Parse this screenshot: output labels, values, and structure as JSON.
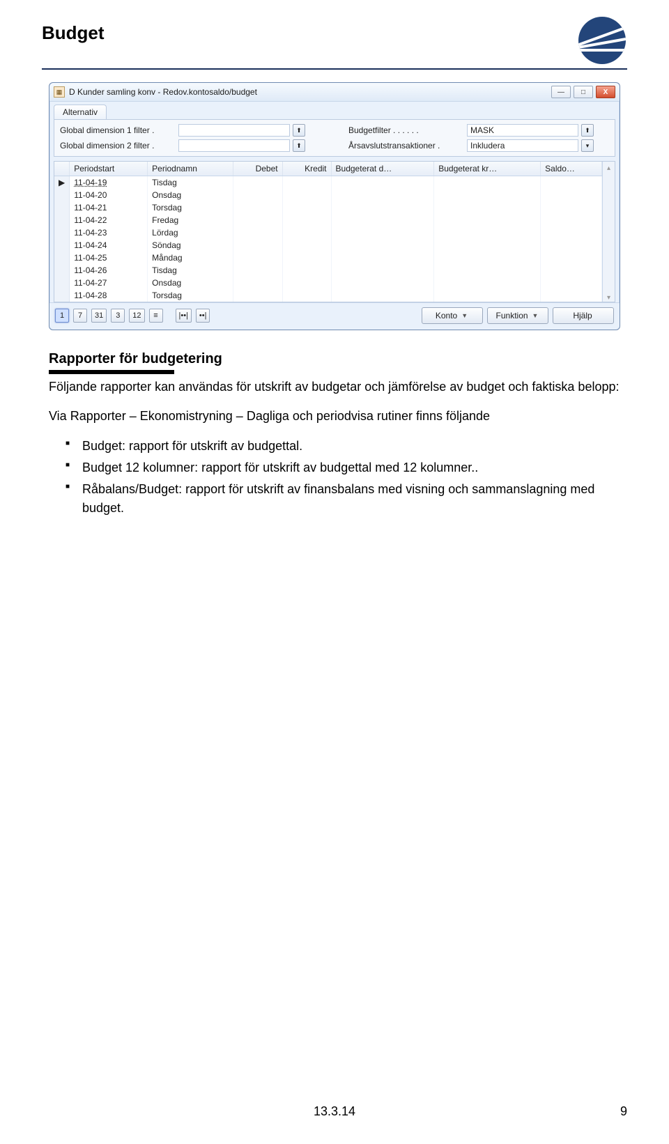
{
  "header": {
    "title": "Budget"
  },
  "window": {
    "icon_label": "📅",
    "title": "D Kunder samling konv - Redov.kontosaldo/budget",
    "buttons": {
      "min": "—",
      "max": "□",
      "close": "X"
    },
    "tab": "Alternativ",
    "filters": {
      "dim1_label": "Global dimension 1 filter .",
      "dim1_value": "",
      "dim2_label": "Global dimension 2 filter .",
      "dim2_value": "",
      "budget_label": "Budgetfilter . . . . . .",
      "budget_value": "MASK",
      "year_label": "Årsavslutstransaktioner .",
      "year_value": "Inkludera"
    },
    "columns": {
      "sel": "",
      "periodstart": "Periodstart",
      "periodnamn": "Periodnamn",
      "debet": "Debet",
      "kredit": "Kredit",
      "budgd": "Budgeterat d…",
      "budgk": "Budgeterat kr…",
      "saldo": "Saldo…"
    },
    "rows": [
      {
        "date": "11-04-19",
        "day": "Tisdag"
      },
      {
        "date": "11-04-20",
        "day": "Onsdag"
      },
      {
        "date": "11-04-21",
        "day": "Torsdag"
      },
      {
        "date": "11-04-22",
        "day": "Fredag"
      },
      {
        "date": "11-04-23",
        "day": "Lördag"
      },
      {
        "date": "11-04-24",
        "day": "Söndag"
      },
      {
        "date": "11-04-25",
        "day": "Måndag"
      },
      {
        "date": "11-04-26",
        "day": "Tisdag"
      },
      {
        "date": "11-04-27",
        "day": "Onsdag"
      },
      {
        "date": "11-04-28",
        "day": "Torsdag"
      }
    ],
    "period_buttons": [
      "1",
      "7",
      "31",
      "3",
      "12",
      "≡",
      "|••|",
      "••|"
    ],
    "bottom_buttons": {
      "konto": "Konto",
      "funktion": "Funktion",
      "hjalp": "Hjälp"
    }
  },
  "section": {
    "heading": "Rapporter för budgetering",
    "intro": "Följande rapporter kan användas för utskrift av budgetar och jämförelse av budget och faktiska belopp:",
    "path": "Via Rapporter – Ekonomistryning – Dagliga och periodvisa rutiner finns följande",
    "bullets": {
      "b1": "Budget: rapport för utskrift av budgettal.",
      "b2": "Budget 12 kolumner: rapport för utskrift av budgettal med 12 kolumner..",
      "b3": "Råbalans/Budget: rapport för utskrift av finansbalans med visning och sammanslagning med budget."
    }
  },
  "footer": {
    "date": "13.3.14",
    "page": "9"
  }
}
